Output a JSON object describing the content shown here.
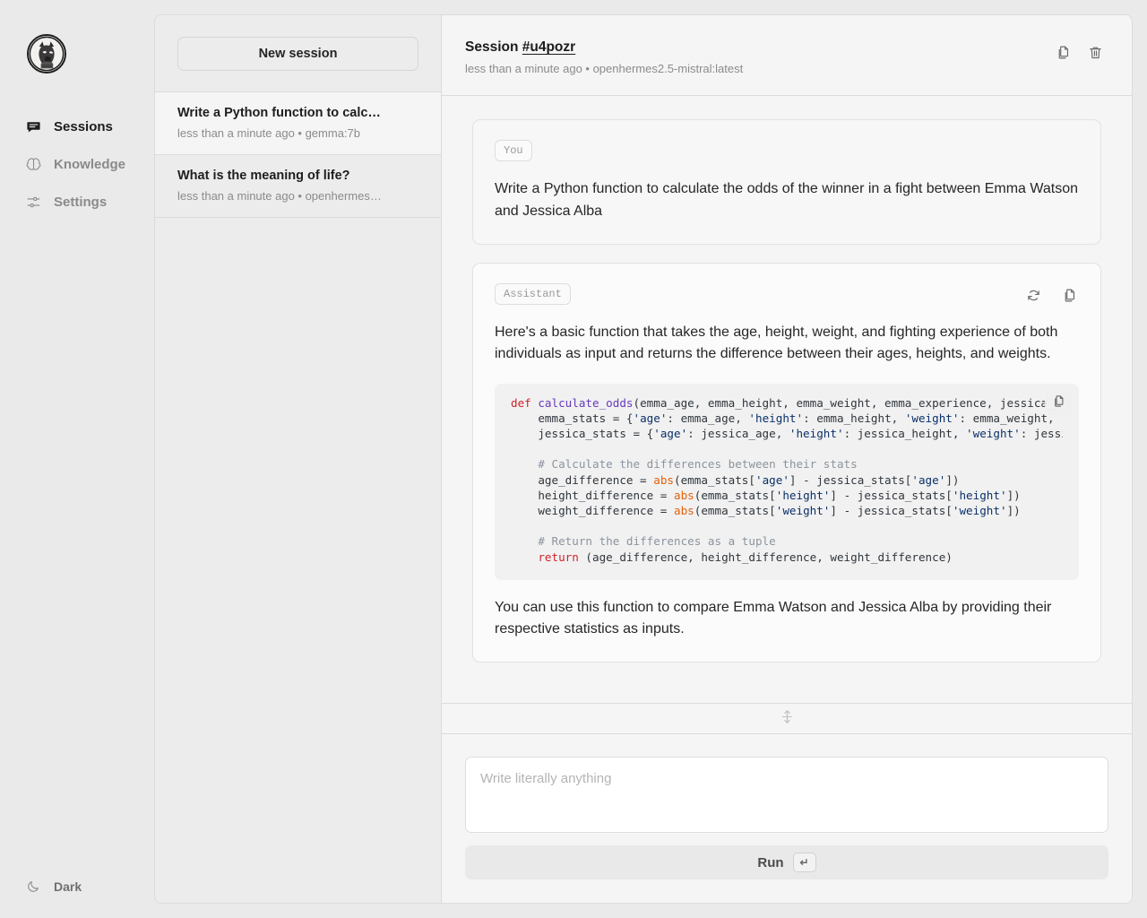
{
  "sidebar": {
    "logo_name": "wolf-crest-logo",
    "items": [
      {
        "label": "Sessions",
        "icon": "chat-bubble-icon",
        "active": true
      },
      {
        "label": "Knowledge",
        "icon": "brain-icon",
        "active": false
      },
      {
        "label": "Settings",
        "icon": "sliders-icon",
        "active": false
      }
    ],
    "theme_toggle": {
      "label": "Dark",
      "icon": "moon-icon"
    }
  },
  "sessions_panel": {
    "new_session_label": "New session",
    "items": [
      {
        "title": "Write a Python function to calc…",
        "meta": "less than a minute ago • gemma:7b",
        "selected": true
      },
      {
        "title": "What is the meaning of life?",
        "meta": "less than a minute ago • openhermes…",
        "selected": false
      }
    ]
  },
  "chat_header": {
    "title_prefix": "Session ",
    "session_id": "#u4pozr",
    "meta": "less than a minute ago • openhermes2.5-mistral:latest",
    "copy_label": "copy-session",
    "delete_label": "delete-session"
  },
  "messages": [
    {
      "role_badge": "You",
      "text": "Write a Python function to calculate the odds of the winner in a fight between Emma Watson and Jessica Alba"
    },
    {
      "role_badge": "Assistant",
      "text_before": "Here's a basic function that takes the age, height, weight, and fighting experience of both individuals as input and returns the difference between their ages, heights, and weights.",
      "text_after": "You can use this function to compare Emma Watson and Jessica Alba by providing their respective statistics as inputs.",
      "code": {
        "language": "python",
        "lines": [
          "def calculate_odds(emma_age, emma_height, emma_weight, emma_experience, jessica_age, jess",
          "    emma_stats = {'age': emma_age, 'height': emma_height, 'weight': emma_weight, 'experie",
          "    jessica_stats = {'age': jessica_age, 'height': jessica_height, 'weight': jessica_weig",
          "",
          "    # Calculate the differences between their stats",
          "    age_difference = abs(emma_stats['age'] - jessica_stats['age'])",
          "    height_difference = abs(emma_stats['height'] - jessica_stats['height'])",
          "    weight_difference = abs(emma_stats['weight'] - jessica_stats['weight'])",
          "",
          "    # Return the differences as a tuple",
          "    return (age_difference, height_difference, weight_difference)"
        ]
      }
    }
  ],
  "composer": {
    "placeholder": "Write literally anything",
    "value": "",
    "run_label": "Run",
    "run_key": "↵"
  },
  "colors": {
    "background": "#eaeaea",
    "panel": "#f5f5f5",
    "border": "#dcdcdc",
    "text": "#262626",
    "muted": "#8b8b8b",
    "code_bg": "#f1f1f1",
    "kw": "#cf222e",
    "fn": "#6639ba",
    "str": "#0a3069",
    "builtin": "#e36209",
    "comment": "#8b949e"
  }
}
